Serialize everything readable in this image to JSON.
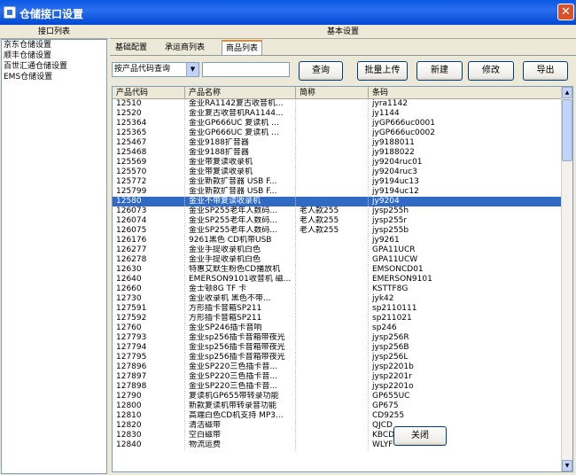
{
  "window": {
    "title": "仓储接口设置",
    "close_glyph": "✕"
  },
  "left": {
    "header": "接口列表",
    "items": [
      "京东仓储设置",
      "顺丰仓储设置",
      "百世汇通仓储设置",
      "EMS仓储设置"
    ]
  },
  "right": {
    "header": "基本设置",
    "tabs": [
      "基础配置",
      "承运商列表",
      "商品列表"
    ],
    "active_tab": 2,
    "query_mode": "按产品代码查询",
    "search_value": "",
    "buttons": {
      "query": "查询",
      "batch_upload": "批量上传",
      "new": "新建",
      "edit": "修改",
      "export": "导出"
    }
  },
  "table": {
    "columns": [
      "产品代码",
      "产品名称",
      "简称",
      "条码"
    ],
    "selected_index": 10,
    "rows": [
      [
        "12510",
        "金业RA1142复古收音机...",
        "",
        "jyra1142"
      ],
      [
        "12520",
        "金业复古收音机RA1144...",
        "",
        "jy1144"
      ],
      [
        "125364",
        "金业GP666UC 复读机 ...",
        "",
        "jyGP666uc0001"
      ],
      [
        "125365",
        "金业GP666UC 复读机 ...",
        "",
        "jyGP666uc0002"
      ],
      [
        "125467",
        "金业9188扩音器",
        "",
        "jy9188011"
      ],
      [
        "125468",
        "金业9188扩音器",
        "",
        "jy9188022"
      ],
      [
        "125569",
        "金业带复读收录机",
        "",
        "jy9204ruc01"
      ],
      [
        "125570",
        "金业带复读收录机",
        "",
        "jy9204ruc3"
      ],
      [
        "125772",
        "金业新款扩音器 USB F...",
        "",
        "jy9194uc13"
      ],
      [
        "125799",
        "金业新款扩音器 USB F...",
        "",
        "jy9194uc12"
      ],
      [
        "12580",
        "金业不带复读收录机",
        "",
        "jy9204"
      ],
      [
        "126073",
        "金业SP255老年人数码...",
        "老人款255",
        "jysp255h"
      ],
      [
        "126074",
        "金业SP255老年人数码...",
        "老人款255",
        "jysp255r"
      ],
      [
        "126075",
        "金业SP255老年人数码...",
        "老人款255",
        "jysp255b"
      ],
      [
        "126176",
        "9261黑色 CD机带USB",
        "",
        "jy9261"
      ],
      [
        "126277",
        "金业手提收录机白色",
        "",
        "GPA11UCR"
      ],
      [
        "126278",
        "金业手提收录机白色",
        "",
        "GPA11UCW"
      ],
      [
        "12630",
        "特惠艾默生粉色CD播放机",
        "",
        "EMSONCD01"
      ],
      [
        "12640",
        "EMERSON9101收音机 磁...",
        "",
        "EMERSON9101"
      ],
      [
        "12660",
        "金士顿8G TF 卡",
        "",
        "KSTTF8G"
      ],
      [
        "12730",
        "金业收录机 黑色不带...",
        "",
        "jyk42"
      ],
      [
        "127591",
        "方形插卡音箱SP211",
        "",
        "sp2110111"
      ],
      [
        "127592",
        "方形插卡音箱SP211",
        "",
        "sp211021"
      ],
      [
        "12760",
        "金业SP246插卡音响",
        "",
        "sp246"
      ],
      [
        "127793",
        "金业sp256插卡音箱带夜光",
        "",
        "jysp256R"
      ],
      [
        "127794",
        "金业sp256插卡音箱带夜光",
        "",
        "jysp256B"
      ],
      [
        "127795",
        "金业sp256插卡音箱带夜光",
        "",
        "jysp256L"
      ],
      [
        "127896",
        "金业SP220三色插卡音...",
        "",
        "jysp2201b"
      ],
      [
        "127897",
        "金业SP220三色插卡音...",
        "",
        "jysp2201r"
      ],
      [
        "127898",
        "金业SP220三色插卡音...",
        "",
        "jysp2201o"
      ],
      [
        "12790",
        "复读机GP655带转录功能",
        "",
        "GP655UC"
      ],
      [
        "12800",
        "新款复读机带转录音功能",
        "",
        "GP675"
      ],
      [
        "12810",
        "高端白色CD机支持 MP3...",
        "",
        "CD9255"
      ],
      [
        "12820",
        "清洁磁带",
        "",
        "QJCD"
      ],
      [
        "12830",
        "空白磁带",
        "",
        "KBCD"
      ],
      [
        "12840",
        "物流运费",
        "",
        "WLYF"
      ]
    ]
  },
  "footer": {
    "close": "关闭"
  }
}
